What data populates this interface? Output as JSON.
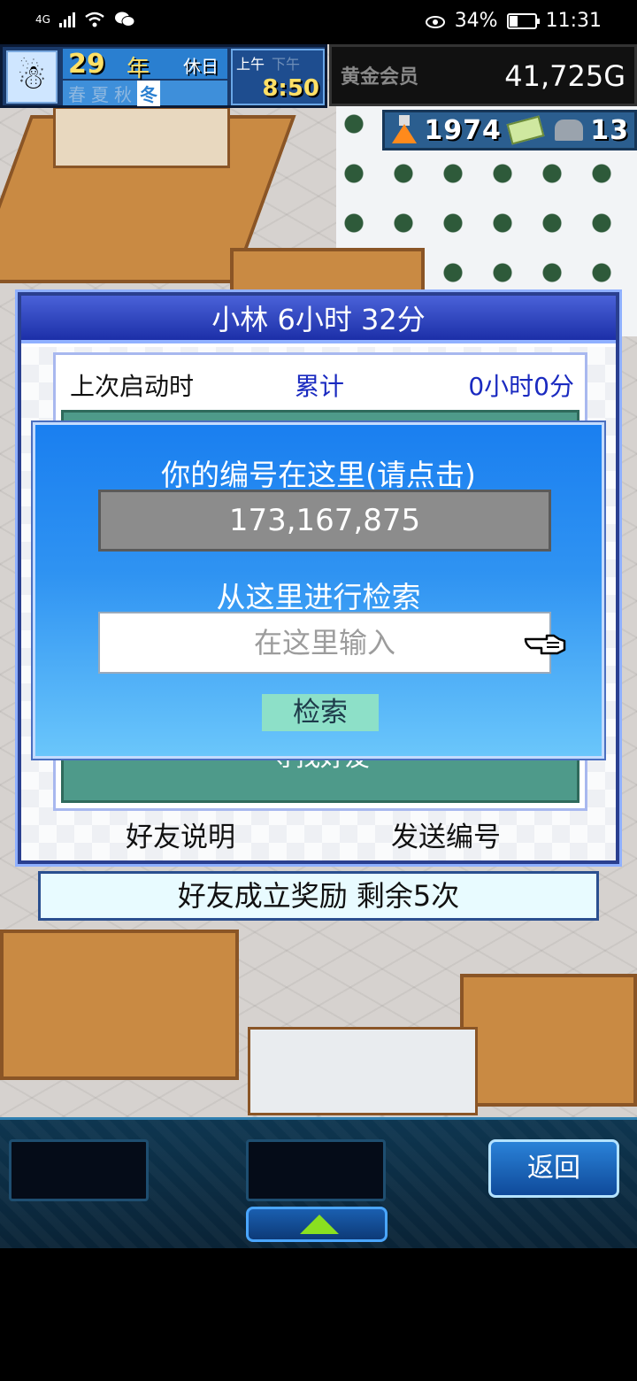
{
  "status_bar": {
    "network": "4G",
    "battery": "34%",
    "battery_level": 0.34,
    "time": "11:31"
  },
  "hud": {
    "year_number": "29",
    "year_unit": "年",
    "day_type": "休日",
    "seasons": [
      "春",
      "夏",
      "秋",
      "冬"
    ],
    "current_season": "冬",
    "am_label": "上午",
    "pm_label": "下午",
    "active_period": "上午",
    "clock": "8:50",
    "member_label": "黄金会员",
    "gold": "41,725G",
    "research_points": "1974",
    "tickets": "13"
  },
  "back_dialog": {
    "title": "小林  6小时 32分",
    "last_start_label": "上次启动时",
    "total_label": "累计",
    "total_value": "0小时0分",
    "find_friends": "寻找好友",
    "friend_info_link": "好友说明",
    "send_id_link": "发送编号"
  },
  "search_dialog": {
    "title": "你的编号在这里(请点击)",
    "your_id": "173,167,875",
    "search_prompt": "从这里进行检索",
    "input_placeholder": "在这里输入",
    "input_value": "",
    "search_button": "检索"
  },
  "reward_bar": {
    "text": "好友成立奖励  剩余5次"
  },
  "bottom_bar": {
    "back_button": "返回"
  },
  "colors": {
    "dialog_title": "#2a3f8f",
    "search_bg": "#2f93f2",
    "search_button": "#8de0c8",
    "panel_green": "#4e9a8a"
  }
}
